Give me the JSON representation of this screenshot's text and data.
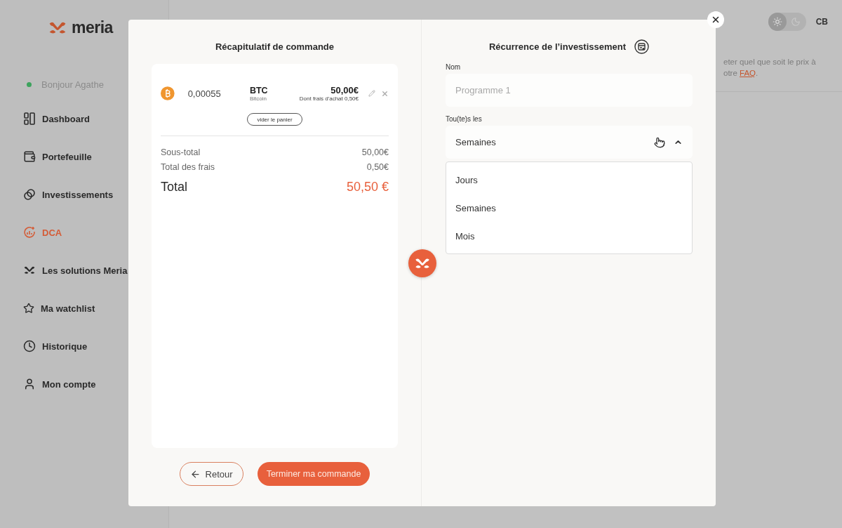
{
  "sidebar": {
    "brand": "meria",
    "greeting": {
      "text": "Bonjour Agathe",
      "online": true
    },
    "items": [
      {
        "kind": "dashboard",
        "label": "Dashboard",
        "selected": false
      },
      {
        "kind": "wallet",
        "label": "Portefeuille",
        "selected": false
      },
      {
        "kind": "circles",
        "label": "Investissements",
        "selected": false
      },
      {
        "kind": "dca",
        "label": "DCA",
        "selected": true
      },
      {
        "kind": "logo",
        "label": "Les solutions Meria",
        "selected": false
      },
      {
        "kind": "star",
        "label": "Ma watchlist",
        "selected": false
      },
      {
        "kind": "clock",
        "label": "Historique",
        "selected": false
      },
      {
        "kind": "user",
        "label": "Mon compte",
        "selected": false
      }
    ]
  },
  "header": {
    "theme_dark": false,
    "initials": "CB"
  },
  "notice": {
    "line_1": "eter quel que soit le prix à",
    "line_2_start": "otre ",
    "link": "FAQ",
    "line_2_end": "."
  },
  "modal": {
    "summary": {
      "title": "Récapitulatif de commande",
      "item": {
        "quantity": "0,00055",
        "symbol": "BTC",
        "name": "Bitcoin",
        "amount": "50,00€",
        "fee_note": "Dont frais d'achat 0,50€"
      },
      "clear_button": "vider le panier",
      "lines": [
        {
          "label": "Sous-total",
          "value": "50,00€"
        },
        {
          "label": "Total des frais",
          "value": "0,50€"
        }
      ],
      "total": {
        "label": "Total",
        "value": "50,50 €"
      },
      "back_button": "Retour",
      "submit_button": "Terminer ma commande"
    },
    "recurrence": {
      "title": "Récurrence de l’investissement",
      "name_label": "Nom",
      "name_placeholder": "Programme 1",
      "frequency_label": "Tou(te)s les",
      "frequency_value": "Semaines",
      "expanded": true,
      "options": [
        "Jours",
        "Semaines",
        "Mois"
      ]
    }
  }
}
